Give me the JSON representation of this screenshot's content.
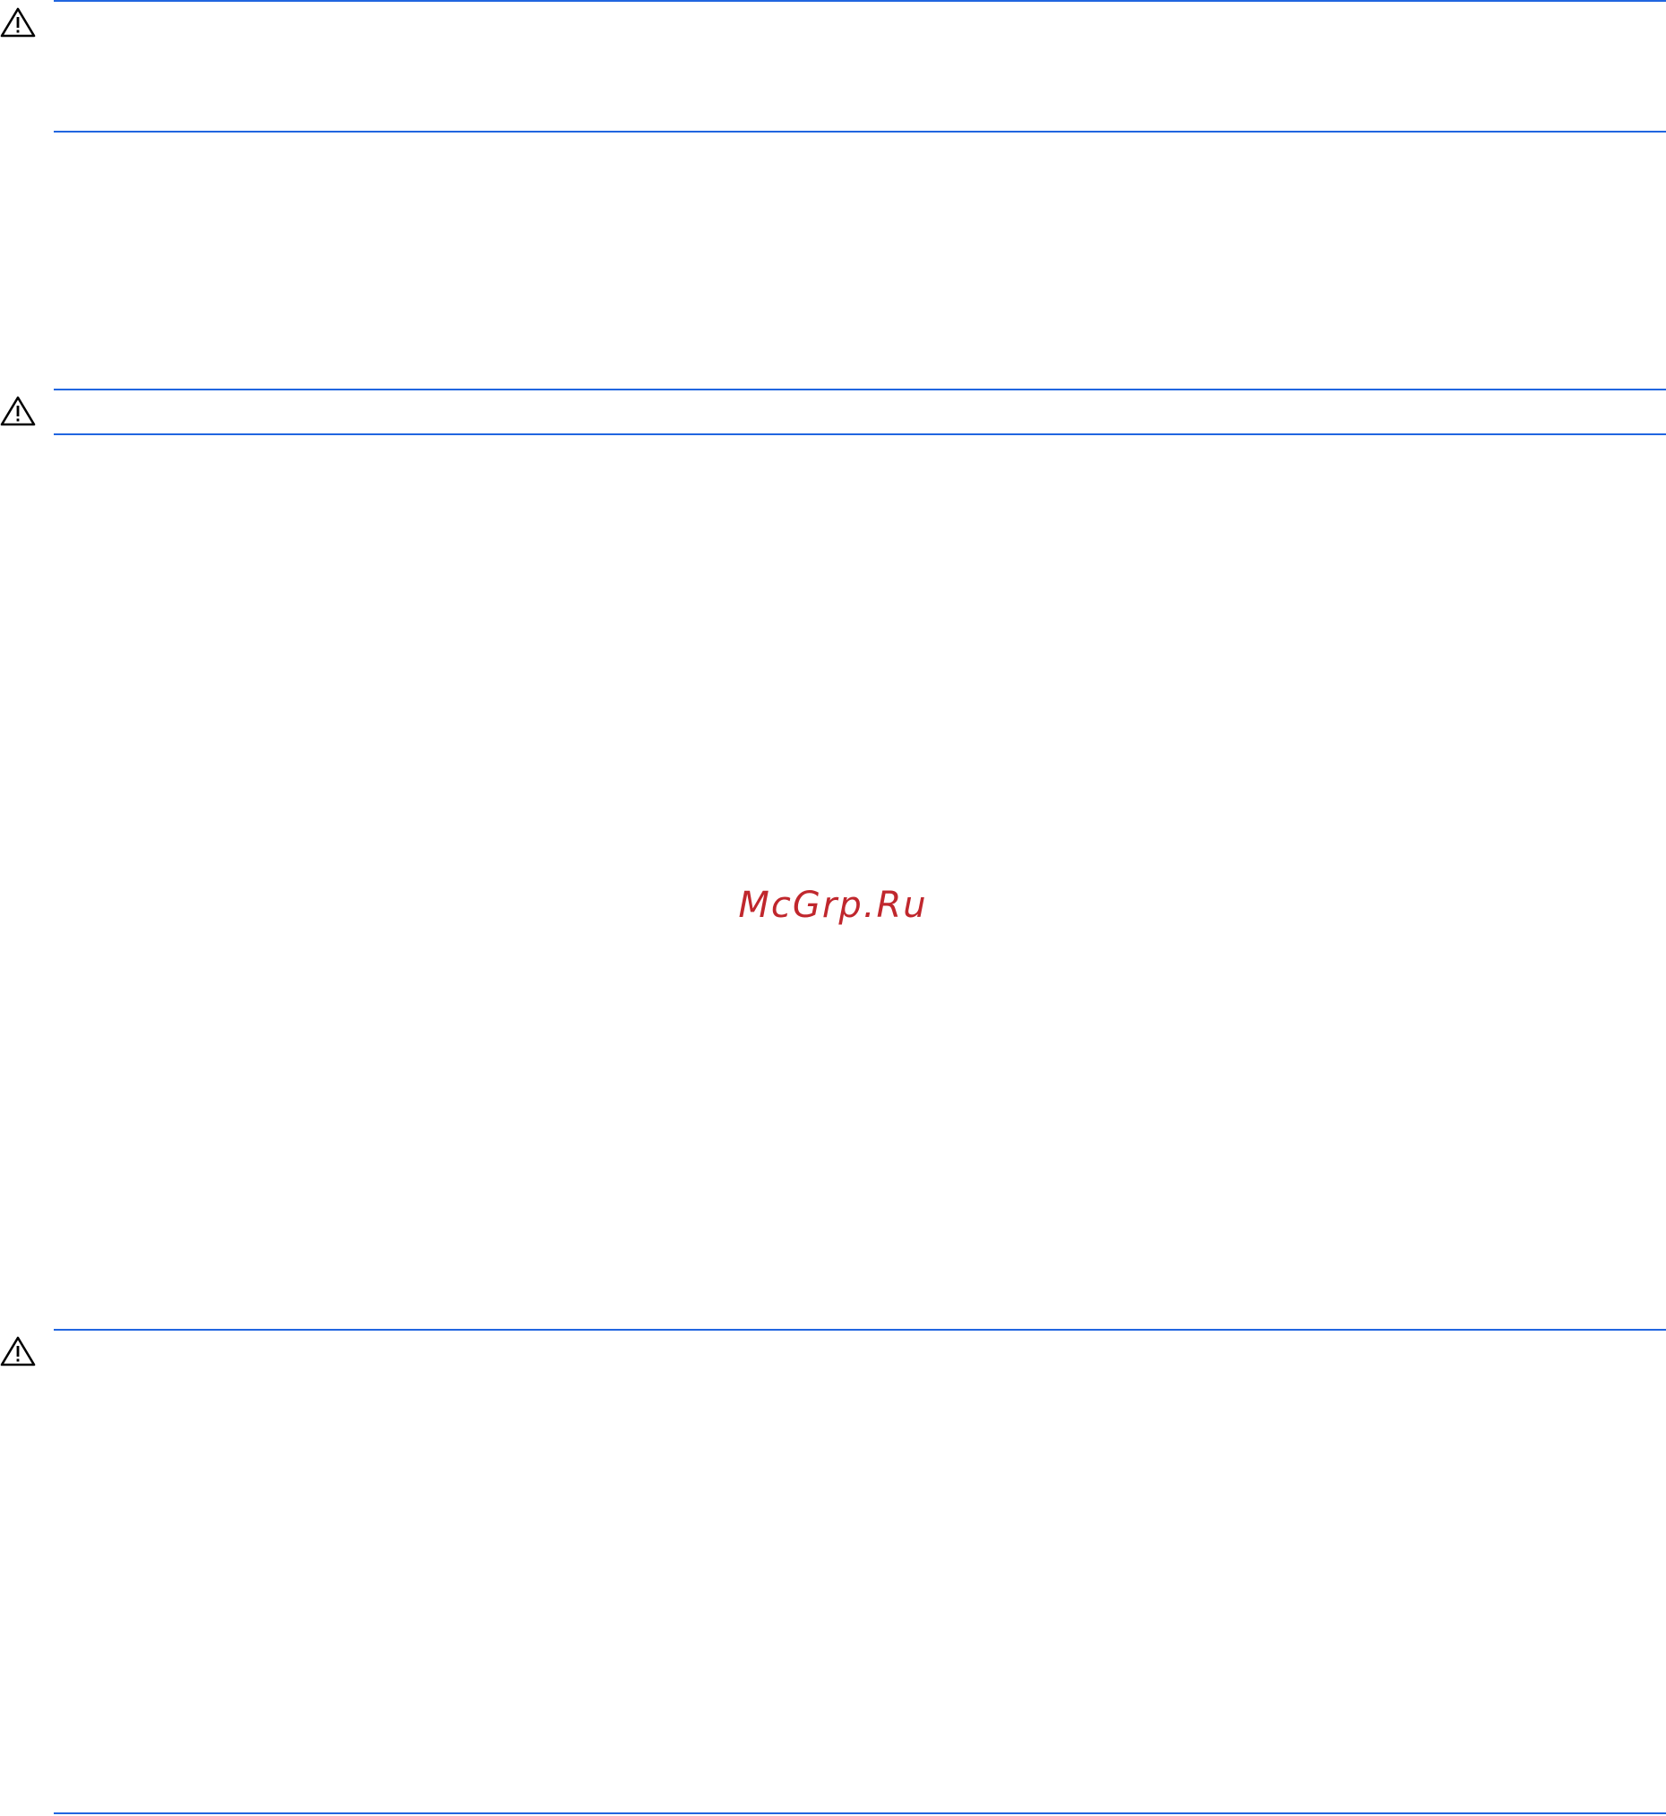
{
  "watermark": {
    "text": "McGrp.Ru",
    "color": "#c0272d"
  },
  "colors": {
    "rule": "#2166e0",
    "icon": "#000000"
  },
  "icons": {
    "warning": "warning-triangle-icon"
  }
}
